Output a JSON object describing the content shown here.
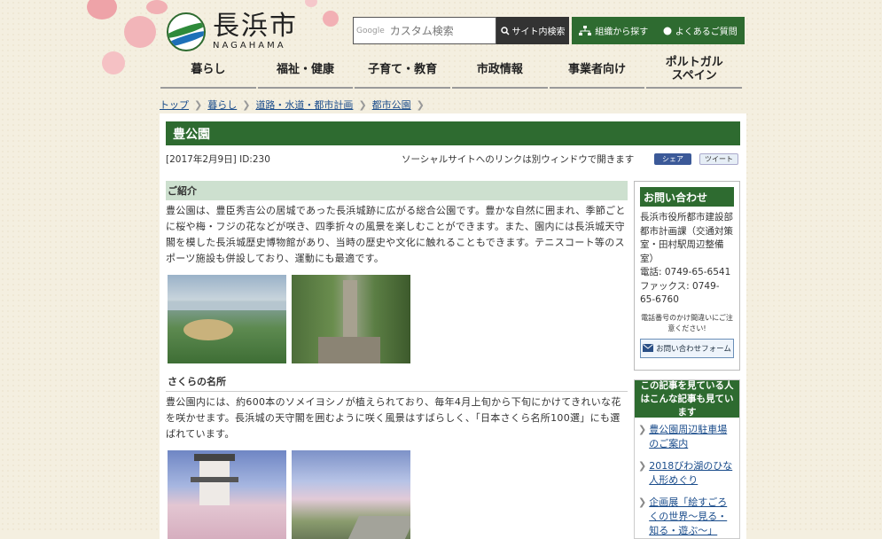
{
  "header": {
    "logo_kanji": "長浜市",
    "logo_roman": "NAGAHAMA",
    "search_brand": "Google",
    "search_placeholder": "カスタム検索",
    "search_button": "サイト内検索",
    "util_org": "組織から探す",
    "util_faq": "よくあるご質問"
  },
  "nav": [
    "暮らし",
    "福祉・健康",
    "子育て・教育",
    "市政情報",
    "事業者向け",
    "ポルトガル\nスペイン"
  ],
  "breadcrumb": [
    "トップ",
    "暮らし",
    "道路・水道・都市計画",
    "都市公園"
  ],
  "page": {
    "title": "豊公園",
    "meta": "[2017年2月9日]  ID:230",
    "social_note": "ソーシャルサイトへのリンクは別ウィンドウで開きます",
    "share_fb": "シェア",
    "share_tw": "ツイート"
  },
  "sections": [
    {
      "heading": "ご紹介",
      "text": "豊公園は、豊臣秀吉公の居城であった長浜城跡に広がる総合公園です。豊かな自然に囲まれ、季節ごとに桜や梅・フジの花などが咲き、四季折々の風景を楽しむことができます。また、園内には長浜城天守閣を模した長浜城歴史博物館があり、当時の歴史や文化に触れることもできます。テニスコート等のスポーツ施設も併設しており、運動にも最適です。"
    },
    {
      "heading": "さくらの名所",
      "text": "豊公園内には、約600本のソメイヨシノが植えられており、毎年4月上旬から下旬にかけてきれいな花を咲かせます。長浜城の天守閣を囲むように咲く風景はすばらしく、「日本さくら名所100選」にも選ばれています。"
    }
  ],
  "inquiry": {
    "title": "お問い合わせ",
    "dept": "長浜市役所都市建設部都市計画課（交通対策室・田村駅周辺整備室）",
    "tel": "電話: 0749-65-6541",
    "fax": "ファックス: 0749-65-6760",
    "note": "電話番号のかけ間違いにご注意ください!",
    "form_button": "お問い合わせフォーム"
  },
  "related": {
    "title": "この記事を見ている人はこんな記事も見ています",
    "items": [
      "豊公園周辺駐車場のご案内",
      "2018びわ湖のひな人形めぐり",
      "企画展「絵すごろくの世界～見る・知る・遊ぶ～」"
    ]
  },
  "colors": {
    "primary": "#2e6b30",
    "section_bg": "#cde0cf",
    "link": "#1a4c8b",
    "page_bg": "#f4efe0"
  }
}
